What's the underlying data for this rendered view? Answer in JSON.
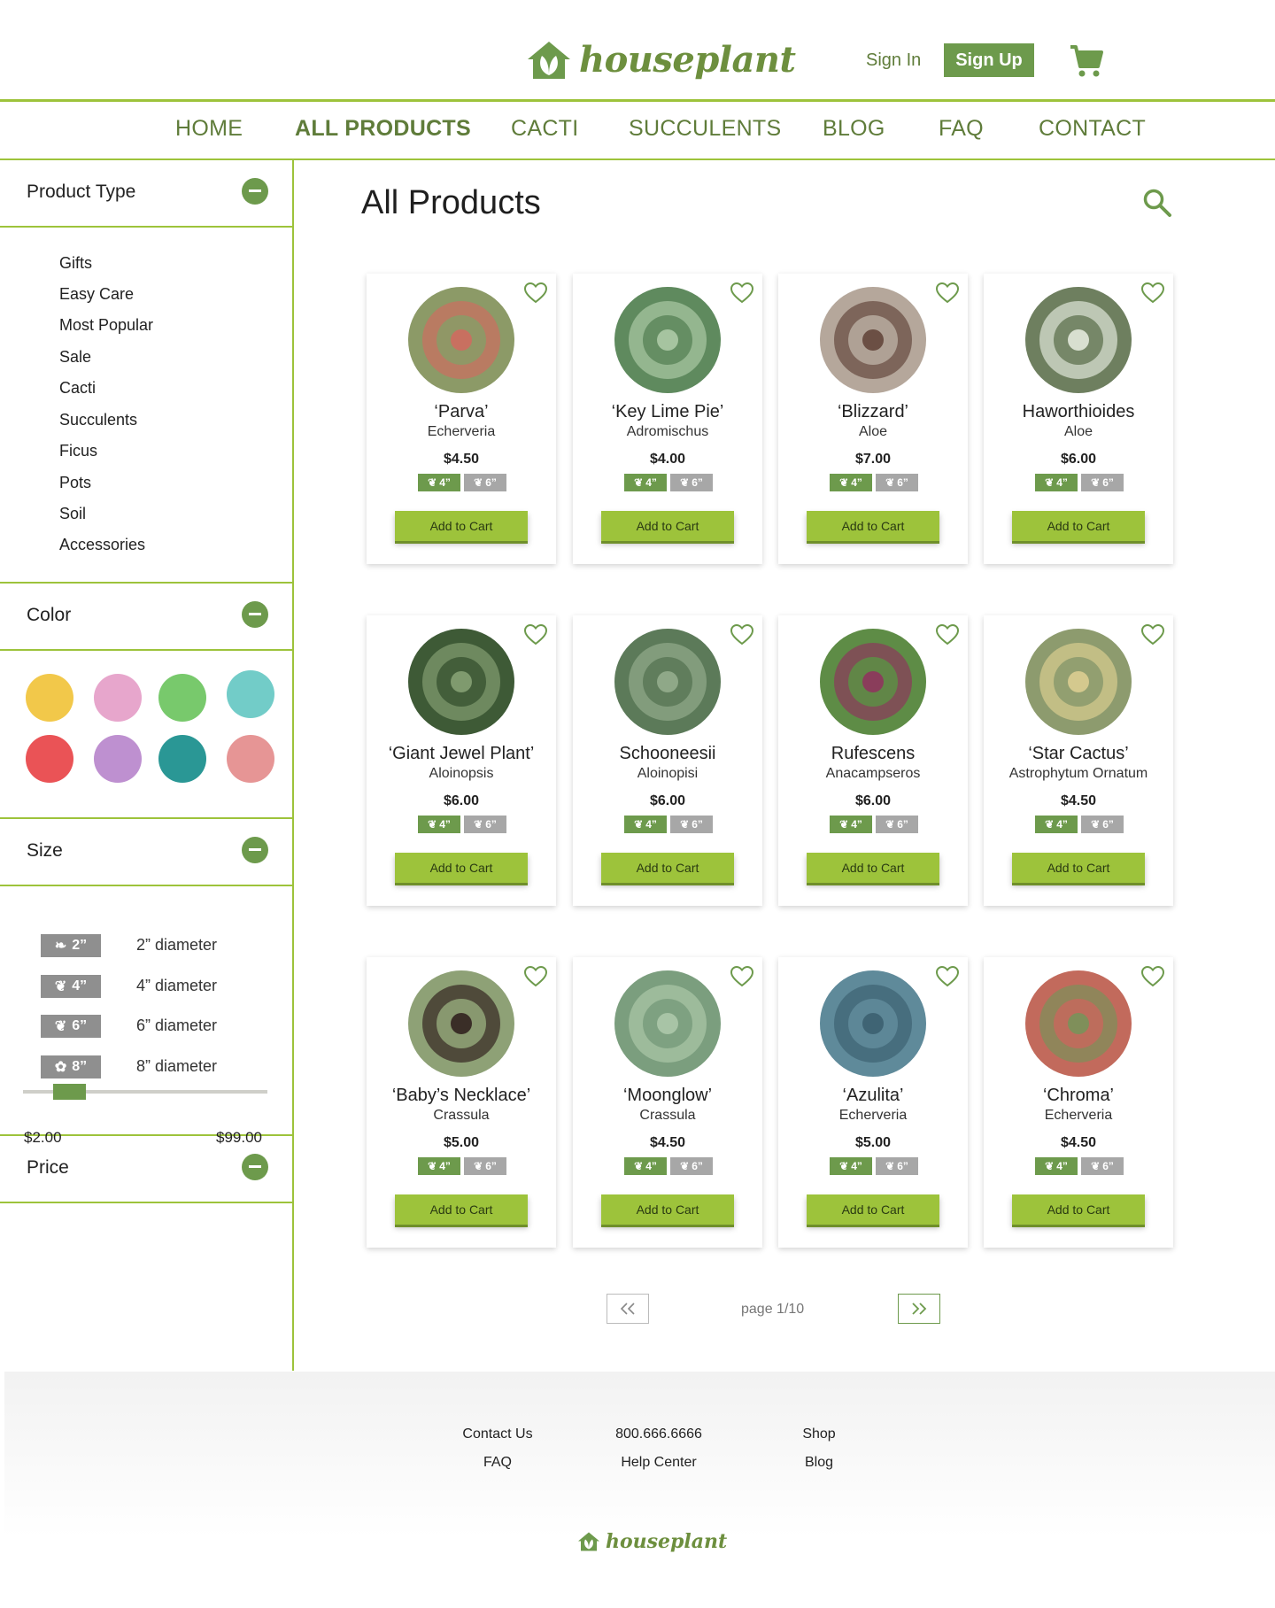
{
  "brand": {
    "name": "houseplant",
    "color": "#6d9a4c",
    "accent": "#9dc33b"
  },
  "header": {
    "sign_in": "Sign In",
    "sign_up": "Sign Up",
    "cart_icon": "cart-icon"
  },
  "nav": [
    {
      "label": "HOME"
    },
    {
      "label": "ALL PRODUCTS",
      "active": true
    },
    {
      "label": "CACTI"
    },
    {
      "label": "SUCCULENTS"
    },
    {
      "label": "BLOG"
    },
    {
      "label": "FAQ"
    },
    {
      "label": "CONTACT"
    }
  ],
  "sidebar": {
    "product_type": {
      "title": "Product Type",
      "items": [
        "Gifts",
        "Easy Care",
        "Most Popular",
        "Sale",
        "Cacti",
        "Succulents",
        "Ficus",
        "Pots",
        "Soil",
        "Accessories"
      ]
    },
    "color": {
      "title": "Color",
      "swatches": [
        "#f2c84a",
        "#e7a6cc",
        "#78c96c",
        "#72ccc8",
        "#ea5356",
        "#be90d0",
        "#2a9795",
        "#e69595"
      ]
    },
    "size": {
      "title": "Size",
      "items": [
        {
          "badge": "2”",
          "label": "2” diameter"
        },
        {
          "badge": "4”",
          "label": "4” diameter"
        },
        {
          "badge": "6”",
          "label": "6” diameter"
        },
        {
          "badge": "8”",
          "label": "8” diameter"
        }
      ]
    },
    "price": {
      "title": "Price",
      "min": "$2.00",
      "max": "$99.00"
    }
  },
  "main": {
    "title": "All Products",
    "add_to_cart": "Add to Cart",
    "size_badges": [
      "4”",
      "6”"
    ],
    "products": [
      {
        "name": "‘Parva’",
        "genus": "Echerveria",
        "price": "$4.50",
        "colors": [
          "#8c9a67",
          "#c87060"
        ]
      },
      {
        "name": "‘Key Lime Pie’",
        "genus": "Adromischus",
        "price": "$4.00",
        "colors": [
          "#5f8a5e",
          "#a6c4a0"
        ]
      },
      {
        "name": "‘Blizzard’",
        "genus": "Aloe",
        "price": "$7.00",
        "colors": [
          "#b5a79b",
          "#6b4f44"
        ]
      },
      {
        "name": "Haworthioides",
        "genus": "Aloe",
        "price": "$6.00",
        "colors": [
          "#6e7f5f",
          "#d8dfd0"
        ]
      },
      {
        "name": "‘Giant Jewel Plant’",
        "genus": "Aloinopsis",
        "price": "$6.00",
        "colors": [
          "#3e5a36",
          "#7f9a6e"
        ]
      },
      {
        "name": "Schooneesii",
        "genus": "Aloinopisi",
        "price": "$6.00",
        "colors": [
          "#5c7a59",
          "#8fa888"
        ]
      },
      {
        "name": "Rufescens",
        "genus": "Anacampseros",
        "price": "$6.00",
        "colors": [
          "#5e8c46",
          "#8a3d5b"
        ]
      },
      {
        "name": "‘Star Cactus’",
        "genus": "Astrophytum Ornatum",
        "price": "$4.50",
        "colors": [
          "#8d9b6e",
          "#d4c98e"
        ]
      },
      {
        "name": "‘Baby’s Necklace’",
        "genus": "Crassula",
        "price": "$5.00",
        "colors": [
          "#8ea176",
          "#3a2e27"
        ]
      },
      {
        "name": "‘Moonglow’",
        "genus": "Crassula",
        "price": "$4.50",
        "colors": [
          "#7b9e7e",
          "#a8c4a6"
        ]
      },
      {
        "name": "‘Azulita’",
        "genus": "Echerveria",
        "price": "$5.00",
        "colors": [
          "#5f8a9a",
          "#3f6474"
        ]
      },
      {
        "name": "‘Chroma’",
        "genus": "Echerveria",
        "price": "$4.50",
        "colors": [
          "#c26a5c",
          "#7f8f5a"
        ]
      }
    ],
    "pagination": {
      "text": "page 1/10",
      "prev": "prev-icon",
      "next": "next-icon"
    }
  },
  "footer": {
    "links": [
      {
        "label": "Contact Us"
      },
      {
        "label": "FAQ"
      },
      {
        "label": "800.666.6666"
      },
      {
        "label": "Help Center"
      },
      {
        "label": "Shop"
      },
      {
        "label": "Blog"
      }
    ],
    "logo": "houseplant"
  }
}
